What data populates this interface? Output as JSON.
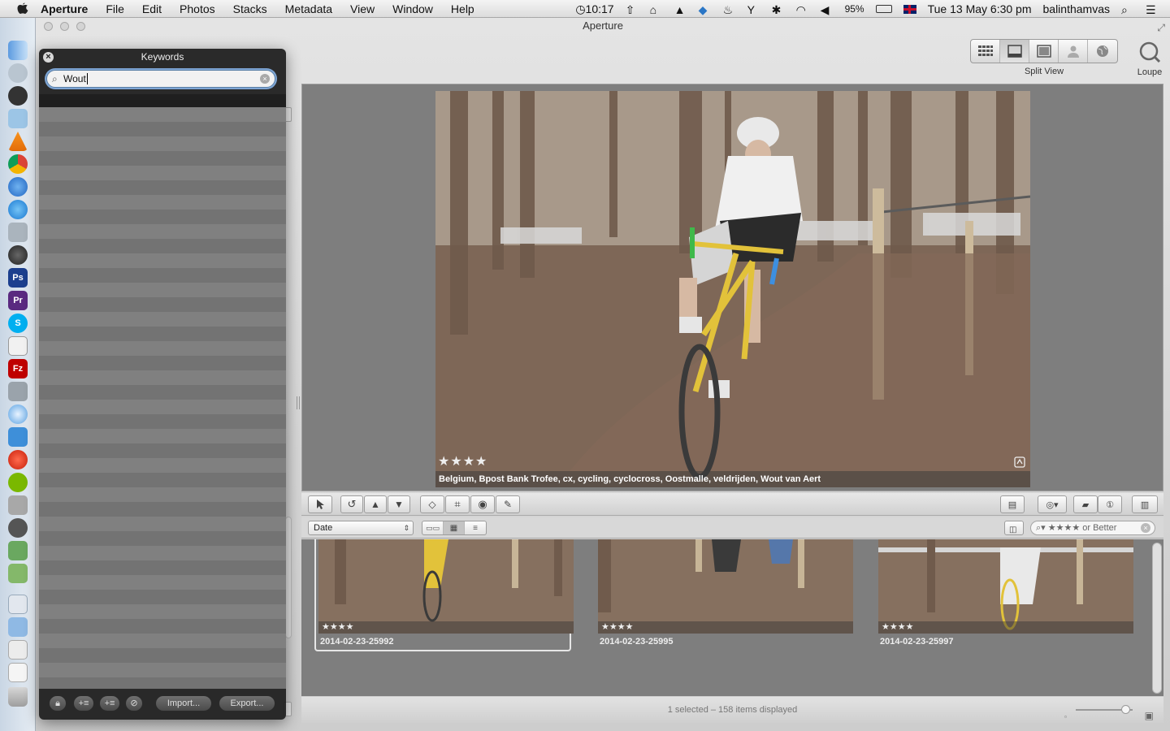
{
  "menubar": {
    "app_name": "Aperture",
    "items": [
      "File",
      "Edit",
      "Photos",
      "Stacks",
      "Metadata",
      "View",
      "Window",
      "Help"
    ],
    "clock": "10:17",
    "battery": "95%",
    "datetime": "Tue 13 May  6:30 pm",
    "user": "balinthamvas"
  },
  "window": {
    "title": "Aperture"
  },
  "toolbar": {
    "split_view_label": "Split View",
    "loupe_label": "Loupe"
  },
  "keywords_hud": {
    "title": "Keywords",
    "search_value": "Wout",
    "import_label": "Import...",
    "export_label": "Export..."
  },
  "viewer": {
    "rating": "★★★★",
    "keywords_caption": "Belgium, Bpost Bank Trofee, cx, cycling, cyclocross, Oostmalle, veldrijden, Wout van Aert"
  },
  "browser": {
    "sort_value": "Date",
    "filter_text": "★★★★ or Better",
    "thumbnails": [
      {
        "name": "2014-02-23-25992",
        "rating": "★★★★"
      },
      {
        "name": "2014-02-23-25995",
        "rating": "★★★★"
      },
      {
        "name": "2014-02-23-25997",
        "rating": "★★★★"
      }
    ],
    "status_text": "1 selected – 158 items displayed"
  }
}
